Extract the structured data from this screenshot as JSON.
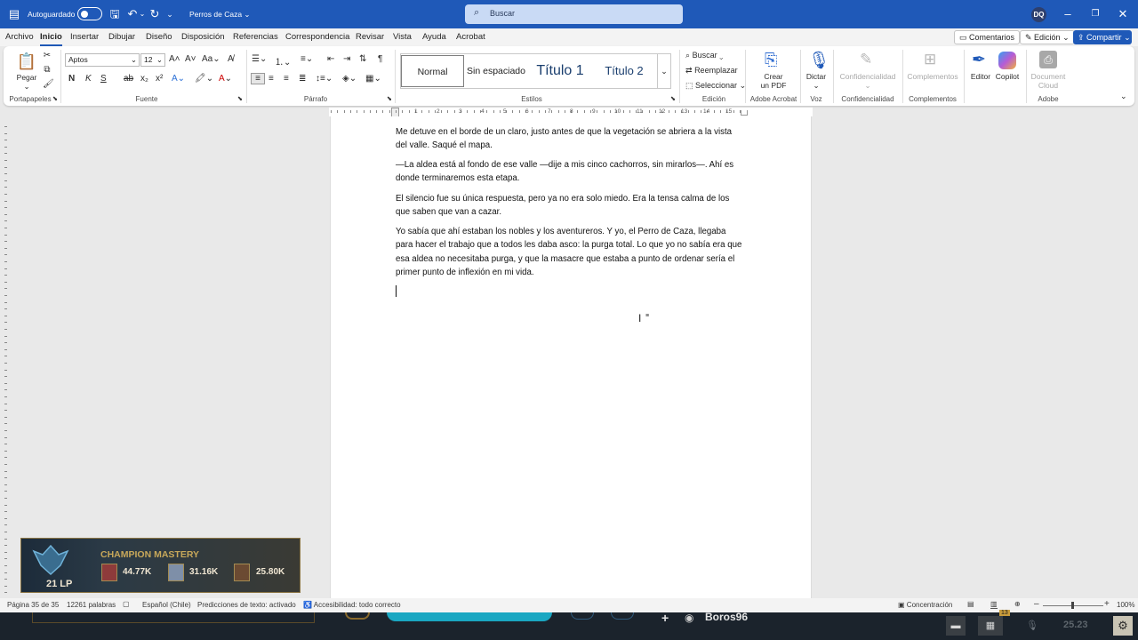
{
  "titlebar": {
    "autosave_label": "Autoguardado",
    "doc_title": "Perros de Caza",
    "search_placeholder": "Buscar",
    "avatar_initials": "DQ"
  },
  "tabs": [
    "Archivo",
    "Inicio",
    "Insertar",
    "Dibujar",
    "Diseño",
    "Disposición",
    "Referencias",
    "Correspondencia",
    "Revisar",
    "Vista",
    "Ayuda",
    "Acrobat"
  ],
  "active_tab": "Inicio",
  "actions": {
    "comments": "Comentarios",
    "editing": "Edición",
    "share": "Compartir"
  },
  "ribbon": {
    "clipboard": {
      "paste": "Pegar",
      "label": "Portapapeles"
    },
    "font": {
      "family": "Aptos",
      "size": "12",
      "label": "Fuente",
      "bold": "N",
      "italic": "K",
      "underline": "S"
    },
    "paragraph": {
      "label": "Párrafo"
    },
    "styles": {
      "items": [
        "Normal",
        "Sin espaciado",
        "Título 1",
        "Título 2"
      ],
      "label": "Estilos"
    },
    "editing": {
      "find": "Buscar",
      "replace": "Reemplazar",
      "select": "Seleccionar",
      "label": "Edición"
    },
    "acrobat": {
      "create_pdf_line1": "Crear",
      "create_pdf_line2": "un PDF",
      "label": "Adobe Acrobat"
    },
    "voice": {
      "dictate": "Dictar",
      "label": "Voz"
    },
    "confidentiality": {
      "button": "Confidencialidad",
      "label": "Confidencialidad"
    },
    "addins": {
      "button": "Complementos",
      "label": "Complementos"
    },
    "editor": {
      "button": "Editor"
    },
    "copilot": {
      "button": "Copilot"
    },
    "adobe": {
      "doc_cloud_line1": "Document",
      "doc_cloud_line2": "Cloud",
      "label": "Adobe"
    }
  },
  "document": {
    "paragraphs": [
      "Me detuve en el borde de un claro, justo antes de que la vegetación se abriera a la vista del valle. Saqué el mapa.",
      "—La aldea está al fondo de ese valle —dije a mis cinco cachorros, sin mirarlos—. Ahí es donde terminaremos esta etapa.",
      "El silencio fue su única respuesta, pero ya no era solo miedo. Era la tensa calma de los que saben que van a cazar.",
      "Yo sabía que ahí estaban los nobles y los aventureros. Y yo, el Perro de Caza, llegaba para hacer el trabajo que a todos les daba asco: la purga total. Lo que yo no sabía era que esa aldea no necesitaba purga, y que la masacre que estaba a punto de ordenar sería el primer punto de inflexión en mi vida."
    ]
  },
  "mastery_overlay": {
    "title": "CHAMPION MASTERY",
    "lp": "21 LP",
    "points": [
      "44.77K",
      "31.16K",
      "25.80K"
    ]
  },
  "statusbar": {
    "page": "Página 35 de 35",
    "words": "12261 palabras",
    "language": "Español (Chile)",
    "predictions": "Predicciones de texto: activado",
    "accessibility": "Accesibilidad: todo correcto",
    "focus": "Concentración",
    "zoom": "100%"
  },
  "taskbar": {
    "user": "Boros96",
    "clock": "25.23",
    "badge": "13"
  },
  "colors": {
    "brand": "#1f59b8",
    "ribbon_bg": "#ffffff",
    "gold": "#c8a85a"
  }
}
